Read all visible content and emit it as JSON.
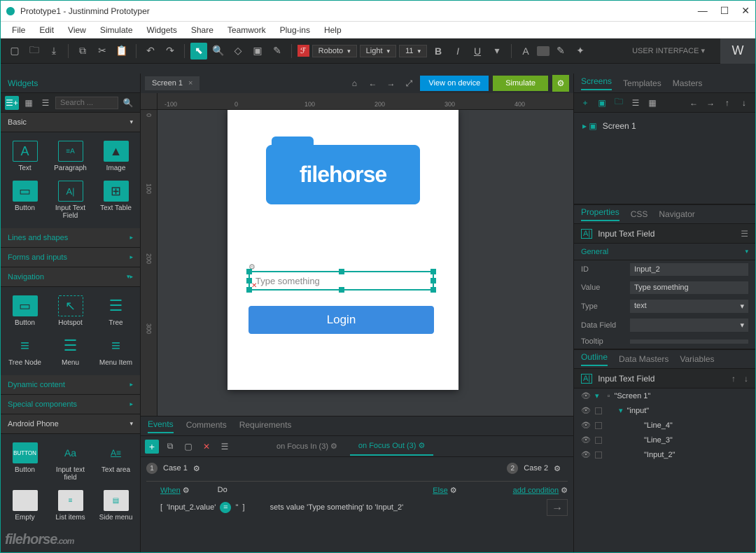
{
  "window": {
    "title": "Prototype1 - Justinmind Prototyper"
  },
  "menu": [
    "File",
    "Edit",
    "View",
    "Simulate",
    "Widgets",
    "Share",
    "Teamwork",
    "Plug-ins",
    "Help"
  ],
  "toolbar": {
    "font_family": "Roboto",
    "font_weight": "Light",
    "font_size": "11",
    "workspace_label": "USER INTERFACE",
    "workspace_letter": "W"
  },
  "left": {
    "title": "Widgets",
    "search_placeholder": "Search ...",
    "category_basic": "Basic",
    "widgets_basic": [
      {
        "label": "Text"
      },
      {
        "label": "Paragraph"
      },
      {
        "label": "Image"
      },
      {
        "label": "Button"
      },
      {
        "label": "Input Text Field"
      },
      {
        "label": "Text Table"
      }
    ],
    "category_lines": "Lines and shapes",
    "category_forms": "Forms and inputs",
    "category_nav": "Navigation",
    "widgets_nav": [
      {
        "label": "Button"
      },
      {
        "label": "Hotspot"
      },
      {
        "label": "Tree"
      },
      {
        "label": "Tree Node"
      },
      {
        "label": "Menu"
      },
      {
        "label": "Menu Item"
      }
    ],
    "category_dynamic": "Dynamic content",
    "category_special": "Special components",
    "category_android": "Android Phone",
    "widgets_android": [
      {
        "label": "Button"
      },
      {
        "label": "Input text field"
      },
      {
        "label": "Text area"
      },
      {
        "label": "Empty"
      },
      {
        "label": "List items"
      },
      {
        "label": "Side menu"
      }
    ]
  },
  "center": {
    "tab": "Screen 1",
    "view_device": "View on device",
    "simulate": "Simulate",
    "ruler_h": [
      "-100",
      "0",
      "100",
      "200",
      "300",
      "400"
    ],
    "ruler_v": [
      "0",
      "100",
      "200",
      "300"
    ],
    "field_placeholder": "Type something",
    "login_label": "Login",
    "logo_text": "filehorse"
  },
  "bottom": {
    "tabs": [
      "Events",
      "Comments",
      "Requirements"
    ],
    "event_tab1": "on Focus In (3)",
    "event_tab2": "on Focus Out (3)",
    "case1": "Case 1",
    "case2": "Case 2",
    "when": "When",
    "do": "Do",
    "else": "Else",
    "add_condition": "add condition",
    "expr_left": "'Input_2.value'",
    "expr_right": "''",
    "action": "sets value 'Type something' to 'Input_2'"
  },
  "right": {
    "tabs": [
      "Screens",
      "Templates",
      "Masters"
    ],
    "screen1": "Screen 1",
    "prop_tabs": [
      "Properties",
      "CSS",
      "Navigator"
    ],
    "prop_title": "Input Text Field",
    "group_general": "General",
    "p_id_label": "ID",
    "p_id_value": "Input_2",
    "p_value_label": "Value",
    "p_value_value": "Type something",
    "p_type_label": "Type",
    "p_type_value": "text",
    "p_data_label": "Data Field",
    "p_tooltip_label": "Tooltip",
    "outline_tabs": [
      "Outline",
      "Data Masters",
      "Variables"
    ],
    "outline_title": "Input Text Field",
    "outline": [
      {
        "name": "\"Screen 1\"",
        "indent": 0,
        "expand": true
      },
      {
        "name": "\"input\"",
        "indent": 1,
        "expand": true
      },
      {
        "name": "\"Line_4\"",
        "indent": 2
      },
      {
        "name": "\"Line_3\"",
        "indent": 2
      },
      {
        "name": "\"Input_2\"",
        "indent": 2
      }
    ]
  }
}
